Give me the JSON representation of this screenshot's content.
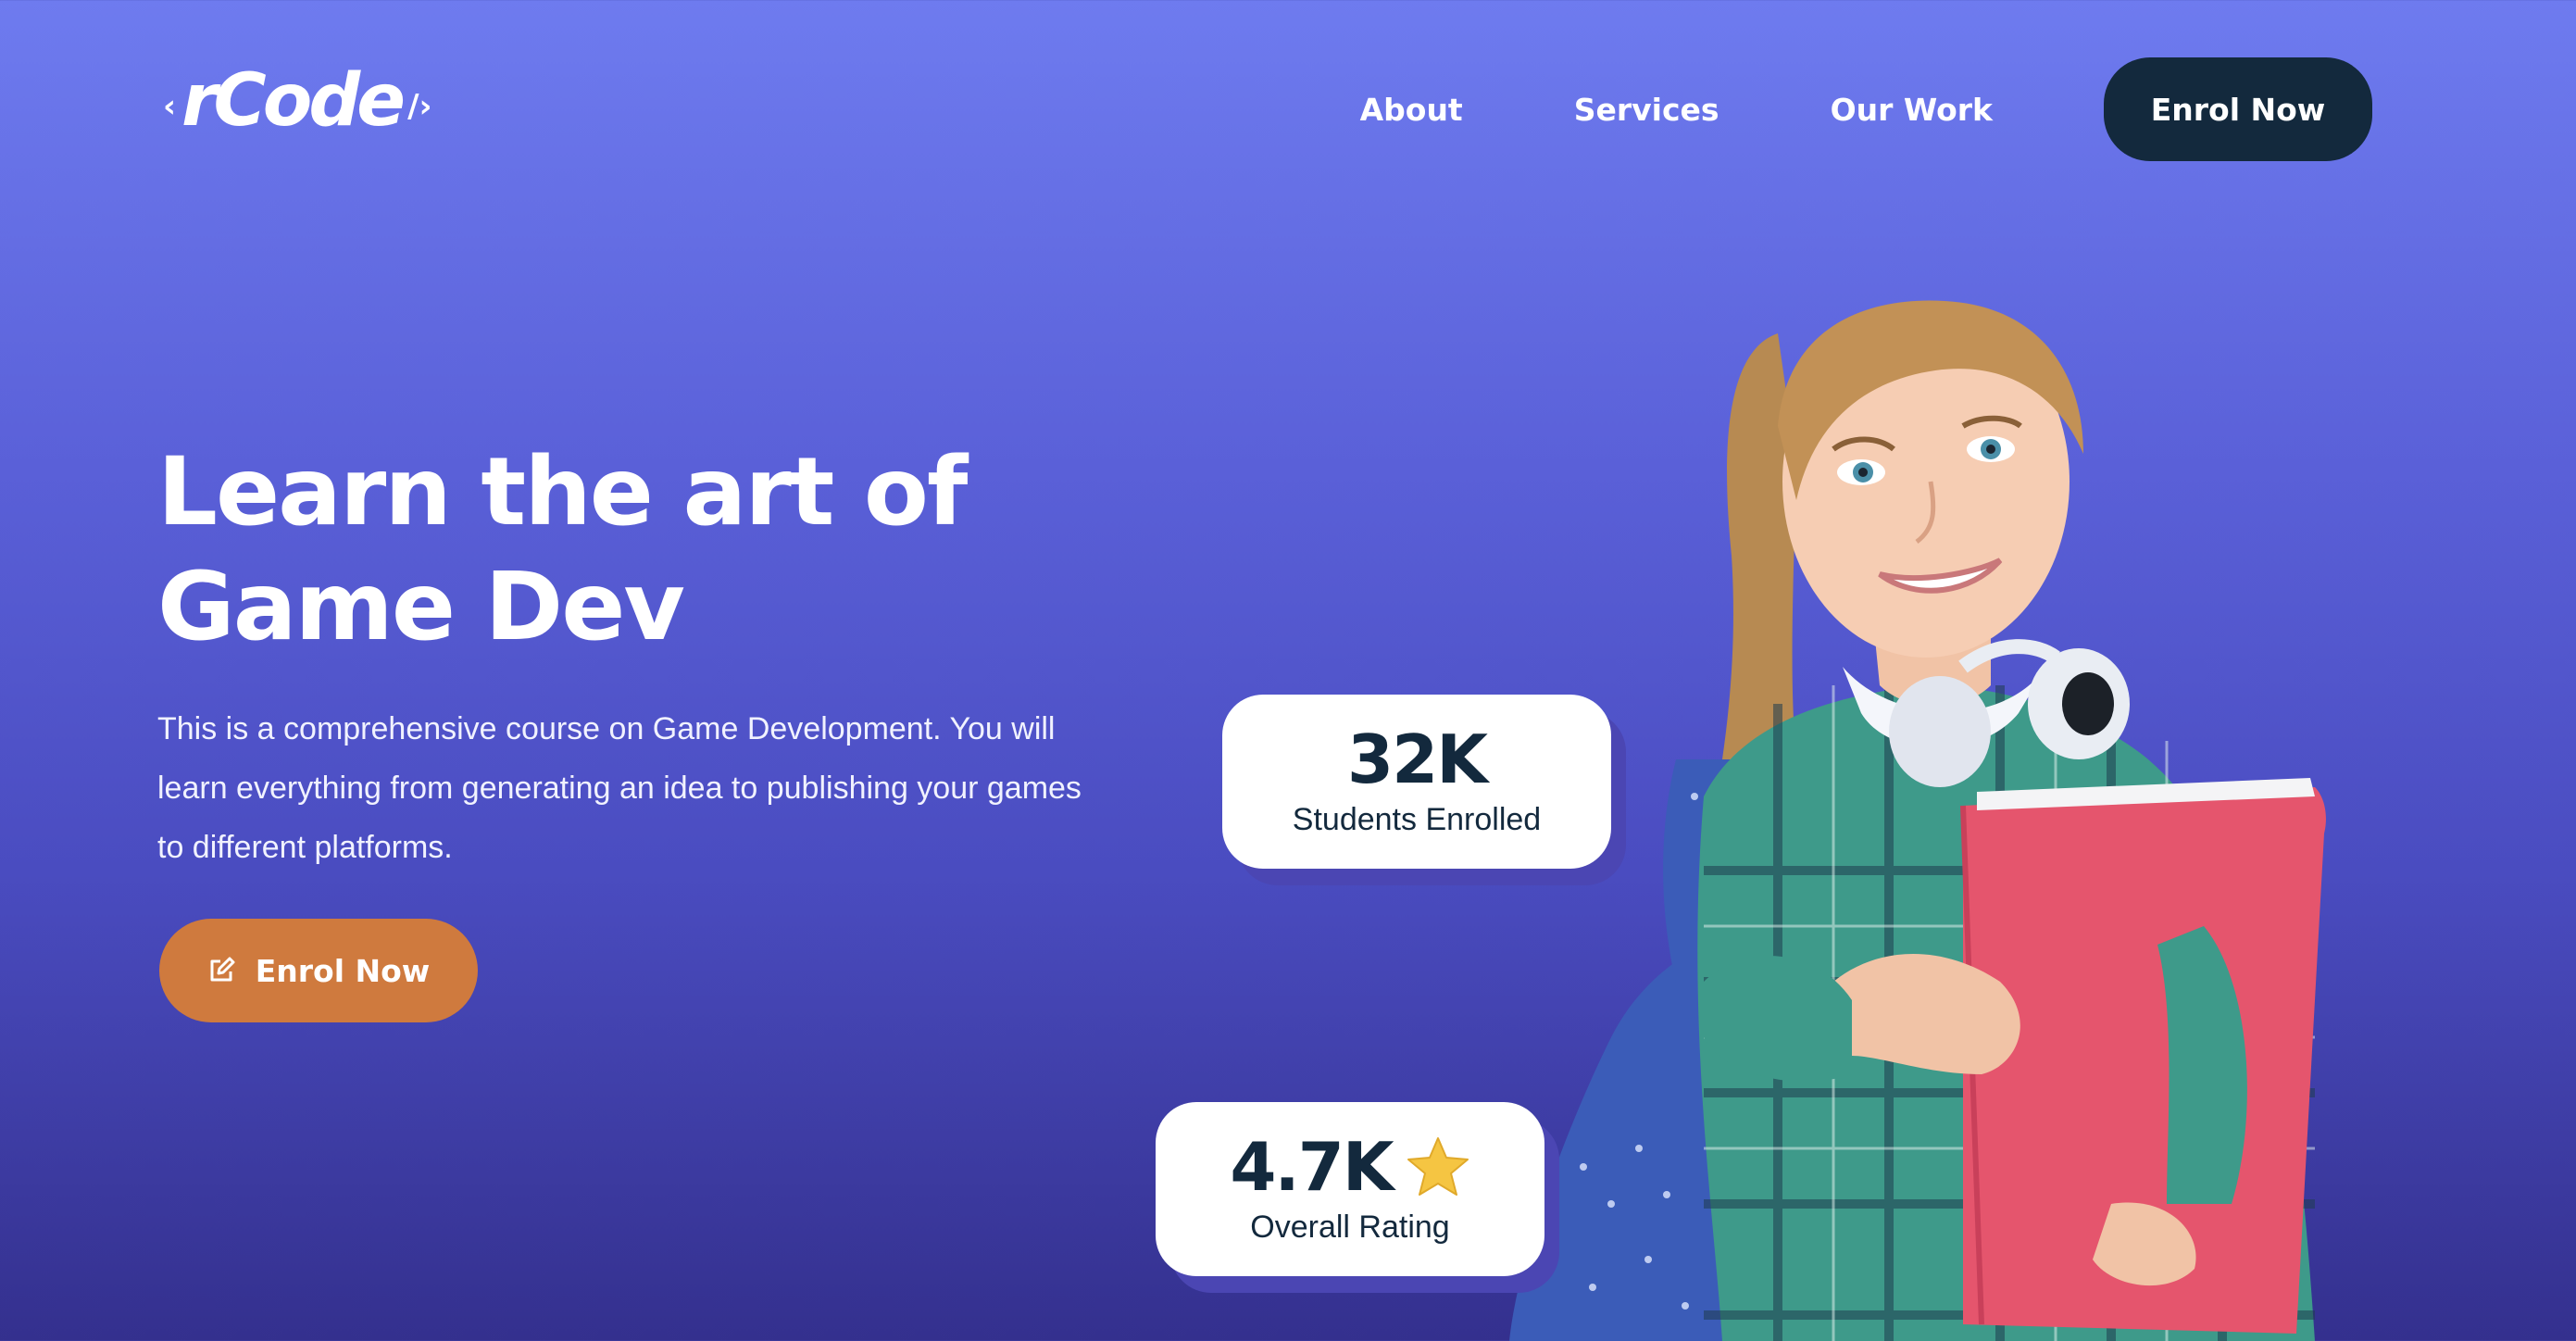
{
  "brand": {
    "bracket_left": "‹",
    "name": "rCode",
    "bracket_right": "/›"
  },
  "nav": {
    "items": [
      {
        "label": "About"
      },
      {
        "label": "Services"
      },
      {
        "label": "Our Work"
      }
    ],
    "cta_label": "Enrol Now"
  },
  "hero": {
    "title_line1": "Learn the art of",
    "title_line2": "Game Dev",
    "description": "This is a comprehensive course on Game Development. You will learn everything from generating an idea to publishing your games to different platforms.",
    "cta_label": "Enrol Now",
    "cta_icon": "edit-icon"
  },
  "stats": [
    {
      "value": "32K",
      "label": "Students Enrolled"
    },
    {
      "value": "4.7K",
      "label": "Overall Rating",
      "icon": "star-icon"
    }
  ],
  "colors": {
    "bg_top": "#6e7bef",
    "bg_bottom": "#34308e",
    "navy": "#13293d",
    "cta_orange": "#cf7a3e",
    "star": "#f5c542"
  }
}
